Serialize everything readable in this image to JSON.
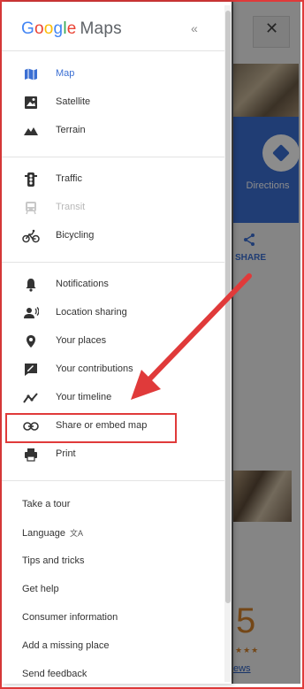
{
  "background": {
    "directions_label": "Directions",
    "share_label": "SHARE",
    "rating_value": "5",
    "rating_stars": "★★★",
    "reviews_link": "ews"
  },
  "drawer": {
    "logo": {
      "g1": "G",
      "o1": "o",
      "o2": "o",
      "g2": "g",
      "l": "l",
      "e": "e",
      "maps": "Maps"
    },
    "collapse_glyph": "«",
    "map_types": [
      {
        "label": "Map",
        "icon": "map-icon",
        "active": true
      },
      {
        "label": "Satellite",
        "icon": "satellite-icon"
      },
      {
        "label": "Terrain",
        "icon": "terrain-icon"
      }
    ],
    "layers": [
      {
        "label": "Traffic",
        "icon": "traffic-light-icon"
      },
      {
        "label": "Transit",
        "icon": "transit-icon",
        "disabled": true
      },
      {
        "label": "Bicycling",
        "icon": "bicycle-icon"
      }
    ],
    "personal": [
      {
        "label": "Notifications",
        "icon": "bell-icon"
      },
      {
        "label": "Location sharing",
        "icon": "location-sharing-icon"
      },
      {
        "label": "Your places",
        "icon": "pin-icon"
      },
      {
        "label": "Your contributions",
        "icon": "contribution-icon"
      },
      {
        "label": "Your timeline",
        "icon": "timeline-icon"
      },
      {
        "label": "Share or embed map",
        "icon": "link-icon"
      },
      {
        "label": "Print",
        "icon": "print-icon"
      }
    ],
    "help_links": [
      "Take a tour",
      "Language",
      "Tips and tricks",
      "Get help",
      "Consumer information",
      "Add a missing place",
      "Send feedback"
    ],
    "language_glyph": "文A"
  },
  "colors": {
    "accent_blue": "#3b6fd3",
    "annotation_red": "#e03a3a",
    "google_blue": "#4285F4",
    "google_red": "#EA4335",
    "google_yellow": "#FBBC05",
    "google_green": "#34A853"
  }
}
